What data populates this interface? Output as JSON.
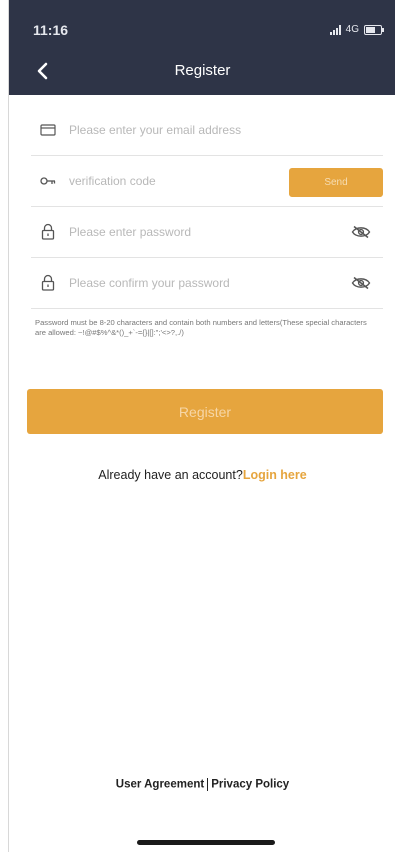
{
  "status_bar": {
    "time": "11:16",
    "network": "4G"
  },
  "header": {
    "title": "Register",
    "back_icon": "chevron-left-icon"
  },
  "form": {
    "email": {
      "placeholder": "Please enter your email address",
      "icon": "envelope-icon"
    },
    "code": {
      "placeholder": "verification code",
      "icon": "key-icon",
      "send_label": "Send"
    },
    "password": {
      "placeholder": "Please enter password",
      "icon": "lock-icon",
      "toggle_icon": "eye-slash-icon"
    },
    "confirm": {
      "placeholder": "Please confirm your password",
      "icon": "lock-icon",
      "toggle_icon": "eye-slash-icon"
    },
    "hint": "Password must be 8-20 characters and contain both numbers and letters(These special characters are allowed: ~!@#$%^&*()_+`-={}|[]:\";'<>?,./)",
    "register_label": "Register"
  },
  "login": {
    "prompt": "Already have an account?",
    "link": "Login here"
  },
  "footer": {
    "agreement": "User Agreement",
    "privacy": "Privacy Policy"
  },
  "colors": {
    "header_bg": "#2e3447",
    "accent": "#e6a53e",
    "text": "#222222",
    "placeholder": "#b8b8b8",
    "divider": "#e3e3e3"
  }
}
